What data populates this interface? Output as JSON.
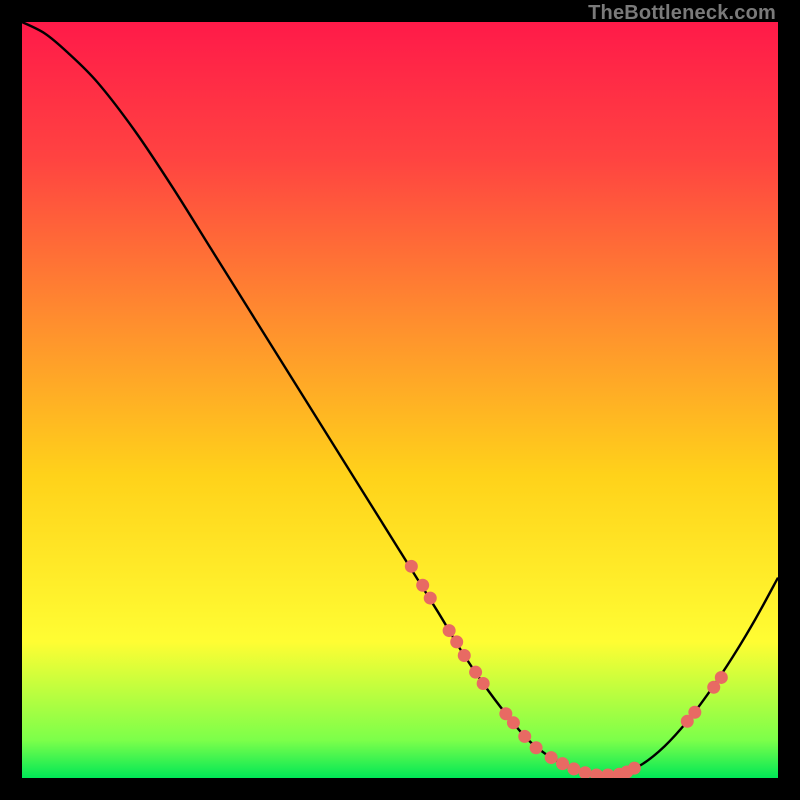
{
  "watermark": "TheBottleneck.com",
  "chart_data": {
    "type": "line",
    "title": "",
    "xlabel": "",
    "ylabel": "",
    "xlim": [
      0,
      100
    ],
    "ylim": [
      0,
      100
    ],
    "grid": false,
    "legend": false,
    "gradient_stops": [
      {
        "offset": 0.0,
        "color": "#ff1a49"
      },
      {
        "offset": 0.18,
        "color": "#ff4341"
      },
      {
        "offset": 0.4,
        "color": "#ff8f2e"
      },
      {
        "offset": 0.6,
        "color": "#ffd21a"
      },
      {
        "offset": 0.82,
        "color": "#fffd33"
      },
      {
        "offset": 0.95,
        "color": "#7cff4a"
      },
      {
        "offset": 1.0,
        "color": "#00e756"
      }
    ],
    "series": [
      {
        "name": "bottleneck-curve",
        "x": [
          0,
          3,
          6,
          10,
          15,
          20,
          25,
          30,
          35,
          40,
          45,
          50,
          55,
          58,
          61,
          64,
          67,
          70,
          73,
          76,
          79,
          82,
          85,
          88,
          91,
          94,
          97,
          100
        ],
        "y": [
          100,
          98.5,
          96,
          92,
          85.5,
          78,
          70,
          62,
          54,
          46,
          38,
          30,
          22,
          17,
          12.5,
          8.5,
          5,
          2.7,
          1.2,
          0.4,
          0.5,
          1.8,
          4.2,
          7.5,
          11.5,
          16,
          21,
          26.5
        ]
      }
    ],
    "markers": {
      "name": "highlight-points",
      "color": "#e86a63",
      "radius": 6.5,
      "points": [
        {
          "x": 51.5,
          "y": 28
        },
        {
          "x": 53,
          "y": 25.5
        },
        {
          "x": 54,
          "y": 23.8
        },
        {
          "x": 56.5,
          "y": 19.5
        },
        {
          "x": 57.5,
          "y": 18
        },
        {
          "x": 58.5,
          "y": 16.2
        },
        {
          "x": 60,
          "y": 14
        },
        {
          "x": 61,
          "y": 12.5
        },
        {
          "x": 64,
          "y": 8.5
        },
        {
          "x": 65,
          "y": 7.3
        },
        {
          "x": 66.5,
          "y": 5.5
        },
        {
          "x": 68,
          "y": 4
        },
        {
          "x": 70,
          "y": 2.7
        },
        {
          "x": 71.5,
          "y": 1.9
        },
        {
          "x": 73,
          "y": 1.2
        },
        {
          "x": 74.5,
          "y": 0.7
        },
        {
          "x": 76,
          "y": 0.4
        },
        {
          "x": 77.5,
          "y": 0.4
        },
        {
          "x": 79,
          "y": 0.5
        },
        {
          "x": 80,
          "y": 0.8
        },
        {
          "x": 81,
          "y": 1.3
        },
        {
          "x": 88,
          "y": 7.5
        },
        {
          "x": 89,
          "y": 8.7
        },
        {
          "x": 91.5,
          "y": 12
        },
        {
          "x": 92.5,
          "y": 13.3
        }
      ]
    }
  }
}
